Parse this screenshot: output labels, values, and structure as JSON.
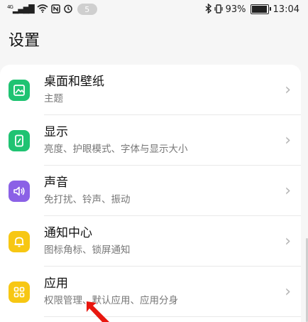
{
  "status_bar": {
    "network": "4G",
    "notification_count": "5",
    "battery": "93%",
    "time": "13:04"
  },
  "page": {
    "title": "设置"
  },
  "items": [
    {
      "title": "桌面和壁纸",
      "subtitle": "主题",
      "icon": "wallpaper-icon",
      "color": "#1fc372"
    },
    {
      "title": "显示",
      "subtitle": "亮度、护眼模式、字体与显示大小",
      "icon": "display-icon",
      "color": "#1fc372"
    },
    {
      "title": "声音",
      "subtitle": "免打扰、铃声、振动",
      "icon": "sound-icon",
      "color": "#8b61e6"
    },
    {
      "title": "通知中心",
      "subtitle": "图标角标、锁屏通知",
      "icon": "bell-icon",
      "color": "#f7c713"
    },
    {
      "title": "应用",
      "subtitle": "权限管理、默认应用、应用分身",
      "icon": "apps-icon",
      "color": "#f7c713"
    }
  ],
  "annotation": {
    "color": "#e8170f"
  }
}
